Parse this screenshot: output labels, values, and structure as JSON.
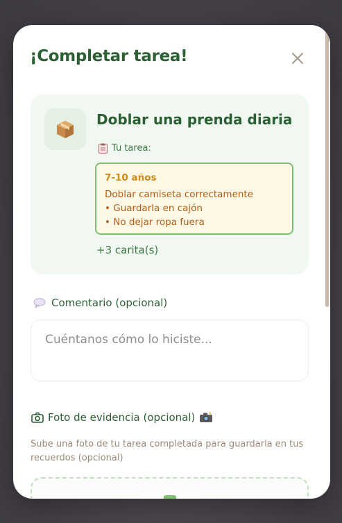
{
  "modal": {
    "title": "¡Completar tarea!",
    "close_icon": "close-icon"
  },
  "task": {
    "icon": "package-icon",
    "title": "Doblar una prenda diaria",
    "instructions_icon": "clipboard-icon",
    "instructions_label": "Tu tarea:",
    "age_group": {
      "label": "7-10 años",
      "lines": [
        "Doblar camiseta correctamente",
        "• Guardarla en cajón",
        "• No dejar ropa fuera"
      ]
    },
    "reward": "+3 carita(s)"
  },
  "comment": {
    "icon": "speech-bubble-icon",
    "label": "Comentario (opcional)",
    "placeholder": "Cuéntanos cómo lo hiciste..."
  },
  "photo": {
    "icon": "camera-icon",
    "label": "Foto de evidencia (opcional)",
    "trailing_icon": "camera-flash-icon",
    "hint": "Sube una foto de tu tarea completada para guardarla en tus recuerdos (opcional)"
  },
  "colors": {
    "primary_green": "#2d5f34",
    "card_bg": "#f1f7f1",
    "age_border": "#7fbf73",
    "age_label": "#d08a16",
    "age_text": "#b25a12"
  }
}
